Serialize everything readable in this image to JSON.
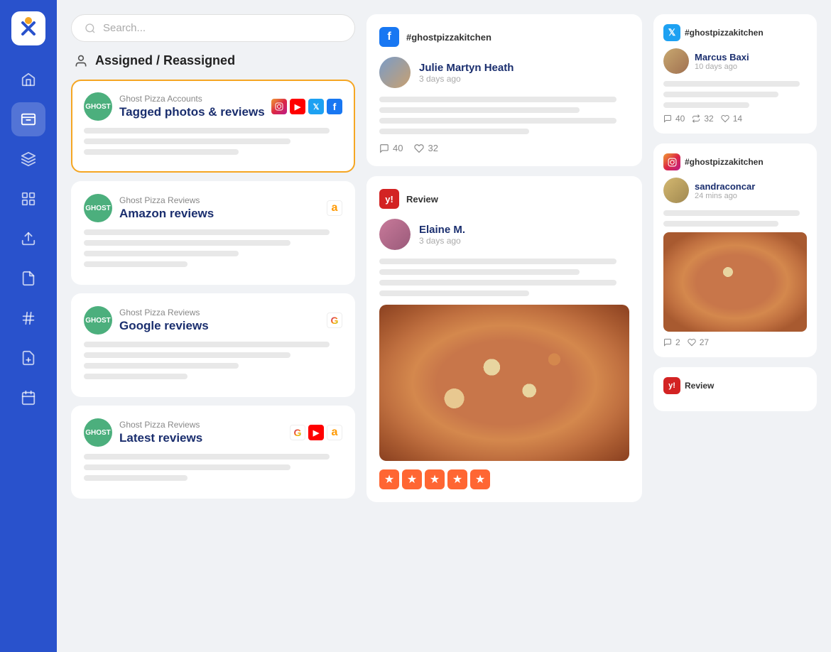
{
  "app": {
    "logo": "X"
  },
  "sidebar": {
    "items": [
      {
        "id": "home",
        "icon": "home",
        "active": false
      },
      {
        "id": "inbox",
        "icon": "inbox",
        "active": true
      },
      {
        "id": "layers",
        "icon": "layers",
        "active": false
      },
      {
        "id": "grid",
        "icon": "grid",
        "active": false
      },
      {
        "id": "upload",
        "icon": "upload",
        "active": false
      },
      {
        "id": "document",
        "icon": "document",
        "active": false
      },
      {
        "id": "hashtag",
        "icon": "hashtag",
        "active": false
      },
      {
        "id": "add-doc",
        "icon": "add-doc",
        "active": false
      },
      {
        "id": "calendar",
        "icon": "calendar",
        "active": false
      }
    ]
  },
  "search": {
    "placeholder": "Search..."
  },
  "section": {
    "title": "Assigned / Reassigned"
  },
  "cards": [
    {
      "id": "card-1",
      "account": "Ghost Pizza Accounts",
      "title": "Tagged photos & reviews",
      "selected": true,
      "platforms": [
        "instagram",
        "youtube",
        "twitter",
        "facebook"
      ]
    },
    {
      "id": "card-2",
      "account": "Ghost Pizza Reviews",
      "title": "Amazon reviews",
      "selected": false,
      "platforms": [
        "amazon"
      ]
    },
    {
      "id": "card-3",
      "account": "Ghost Pizza Reviews",
      "title": "Google reviews",
      "selected": false,
      "platforms": [
        "google"
      ]
    },
    {
      "id": "card-4",
      "account": "Ghost Pizza Reviews",
      "title": "Latest reviews",
      "selected": false,
      "platforms": [
        "google",
        "youtube",
        "amazon"
      ]
    }
  ],
  "middle_posts": [
    {
      "id": "post-1",
      "platform": "facebook",
      "platform_label": "#ghostpizzakitchen",
      "user_name": "Julie Martyn Heath",
      "user_time": "3 days ago",
      "comments": 40,
      "likes": 32
    },
    {
      "id": "post-2",
      "platform": "yelp",
      "platform_label": "Review",
      "user_name": "Elaine M.",
      "user_time": "3 days ago",
      "has_image": true,
      "has_stars": true,
      "star_count": 5
    }
  ],
  "right_posts": [
    {
      "id": "rpost-1",
      "platform": "twitter",
      "platform_label": "#ghostpizzakitchen",
      "user_name": "Marcus Baxi",
      "user_time": "10 days ago",
      "comments": 40,
      "retweets": 32,
      "likes": 14
    },
    {
      "id": "rpost-2",
      "platform": "instagram",
      "platform_label": "#ghostpizzakitchen",
      "user_name": "sandraconcar",
      "user_time": "24 mins ago",
      "has_image": true,
      "comments": 2,
      "likes": 27
    },
    {
      "id": "rpost-3",
      "platform": "yelp",
      "platform_label": "Review",
      "user_name": ""
    }
  ]
}
